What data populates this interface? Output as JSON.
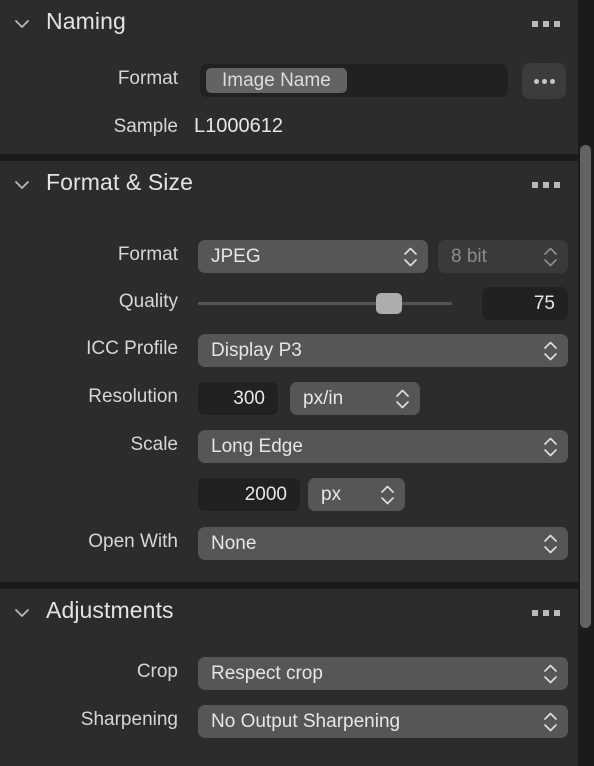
{
  "panel": {
    "accent_color": "#565656",
    "background_color": "#2c2c2c",
    "panel_background_color": "#1b1b1b"
  },
  "sections": [
    {
      "title": "Naming",
      "disclosure_icon": "chevron-down-icon",
      "menu_icon": "ellipsis-icon",
      "rows": [
        {
          "label": "Format",
          "token": "Image Name",
          "more_button": "..."
        },
        {
          "label": "Sample",
          "value": "L1000612"
        }
      ]
    },
    {
      "title": "Format & Size",
      "disclosure_icon": "chevron-down-icon",
      "menu_icon": "ellipsis-icon",
      "rows": [
        {
          "label": "Format",
          "value": "JPEG",
          "depth": "8 bit"
        },
        {
          "label": "Quality",
          "slider_value": 75,
          "slider_min": 0,
          "slider_max": 100,
          "field_value": "75"
        },
        {
          "label": "ICC Profile",
          "value": "Display P3"
        },
        {
          "label": "Resolution",
          "field_value": "300",
          "unit": "px/in"
        },
        {
          "label": "Scale",
          "value": "Long Edge"
        },
        {
          "label": "",
          "field_value": "2000",
          "unit": "px"
        },
        {
          "label": "Open With",
          "value": "None"
        }
      ]
    },
    {
      "title": "Adjustments",
      "disclosure_icon": "chevron-down-icon",
      "menu_icon": "ellipsis-icon",
      "rows": [
        {
          "label": "Crop",
          "value": "Respect crop"
        },
        {
          "label": "Sharpening",
          "value": "No Output Sharpening"
        }
      ]
    }
  ]
}
